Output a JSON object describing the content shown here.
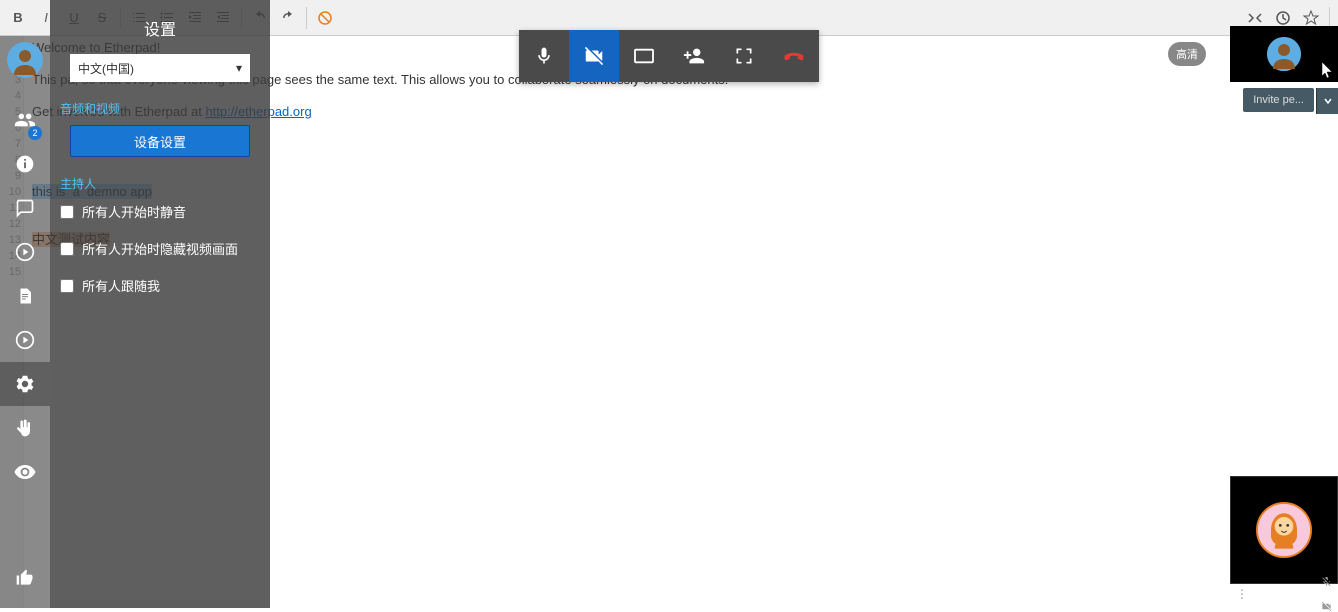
{
  "toolbar": {
    "bold": "B",
    "italic": "I",
    "underline": "U",
    "strike": "S"
  },
  "gutter": [
    "1",
    "2",
    "3",
    "4",
    "5",
    "6",
    "7",
    "8",
    "9",
    "10",
    "11",
    "12",
    "13",
    "14",
    "15"
  ],
  "doc": {
    "line1": "Welcome to Etherpad!",
    "line3_pre": "This pa",
    "line3_post": ", so that everyone viewing this page sees the same text. This allows you to collaborate seamlessly on documents!",
    "line5_pre": "Get involved with Etherpad at ",
    "line5_link": "http://etherpad.org",
    "line10": "this is  a  demno app",
    "line13": "中文测试内容"
  },
  "sidebar": {
    "participant_badge": "2"
  },
  "settings": {
    "title": "设置",
    "language_selected": "中文(中国)",
    "av_label": "音频和视频",
    "device_settings_btn": "设备设置",
    "host_label": "主持人",
    "check_mute": "所有人开始时静音",
    "check_hide_video": "所有人开始时隐藏视频画面",
    "check_follow": "所有人跟随我"
  },
  "call": {
    "hd": "高清"
  },
  "invite": {
    "label": "Invite pe..."
  }
}
